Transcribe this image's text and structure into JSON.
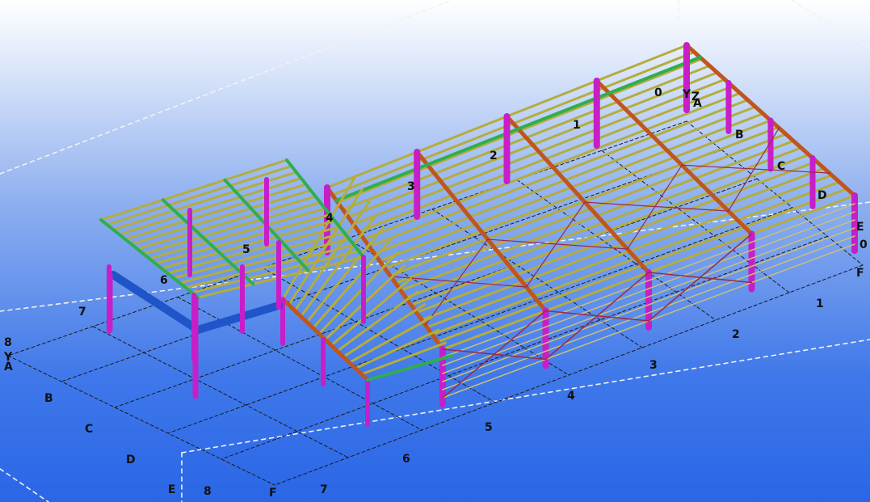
{
  "view": {
    "colors": {
      "background_top": "#ffffff",
      "background_bottom": "#2a66e6",
      "grid_line": "#1a1a1a",
      "workarea_box": "#f2f2f2",
      "purlin": "#b4ad3c",
      "rafter": "#c0551e",
      "column": "#c81ec8",
      "bracing": "#9a2a4a",
      "eave_strut": "#2fae4f",
      "mezzanine_beam": "#1f55c8",
      "cladding_rail": "#c7c07a"
    },
    "grid_labels_numbers": [
      "0",
      "1",
      "2",
      "3",
      "4",
      "5",
      "6",
      "7",
      "8"
    ],
    "grid_labels_letters": [
      "A",
      "B",
      "C",
      "D",
      "E",
      "F"
    ],
    "axis_labels": [
      "Y",
      "Z",
      "A"
    ]
  }
}
